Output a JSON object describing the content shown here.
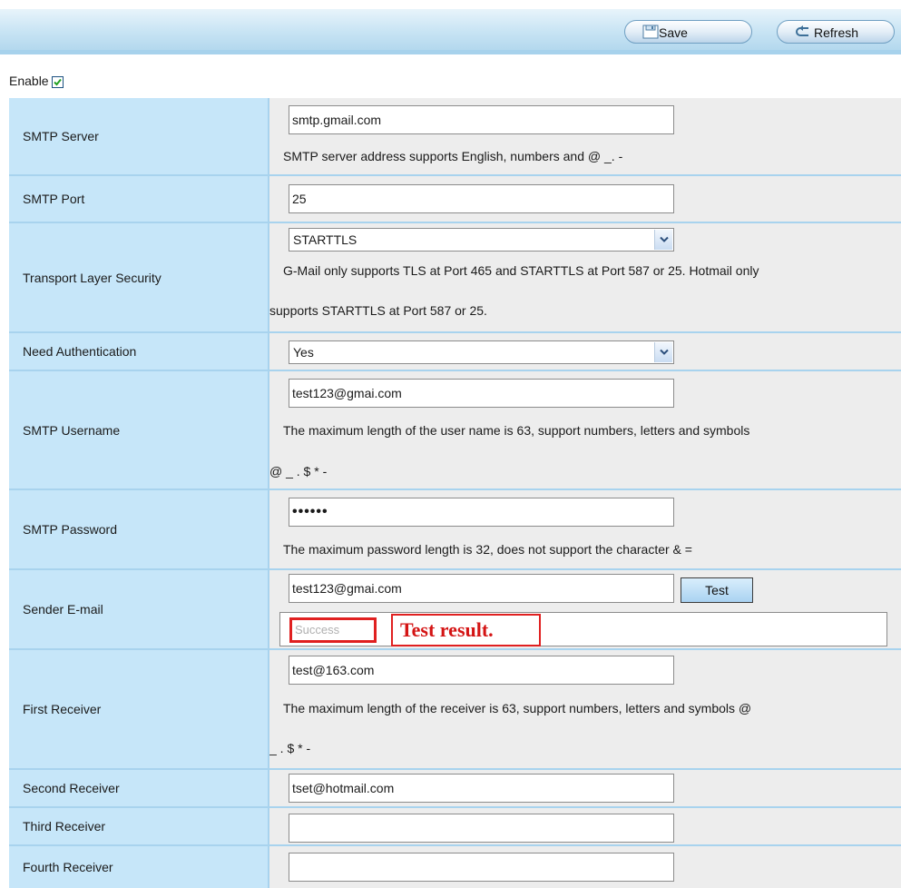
{
  "toolbar": {
    "save_label": "Save",
    "refresh_label": "Refresh"
  },
  "enable": {
    "label": "Enable",
    "checked": true
  },
  "smtp_server": {
    "label": "SMTP Server",
    "value": "smtp.gmail.com",
    "note": "SMTP server address supports English, numbers and @ _. -"
  },
  "smtp_port": {
    "label": "SMTP Port",
    "value": "25"
  },
  "tls": {
    "label": "Transport Layer Security",
    "selected": "STARTTLS",
    "note_line1": "G-Mail only supports TLS at Port 465 and STARTTLS at Port 587 or 25. Hotmail only",
    "note_line2": "supports STARTTLS at Port 587 or 25."
  },
  "need_auth": {
    "label": "Need Authentication",
    "selected": "Yes"
  },
  "smtp_username": {
    "label": "SMTP Username",
    "value": "test123@gmai.com",
    "note_line1": "The maximum length of the user name is 63, support numbers, letters and symbols",
    "note_line2": "@ _ . $ * -"
  },
  "smtp_password": {
    "label": "SMTP Password",
    "value": "••••••",
    "note": "The maximum password length is 32, does not support the character & ="
  },
  "sender_email": {
    "label": "Sender E-mail",
    "value": "test123@gmai.com",
    "test_label": "Test",
    "result_status": "Success",
    "result_annotation": "Test result."
  },
  "first_receiver": {
    "label": "First Receiver",
    "value": "test@163.com",
    "note_line1": "The maximum length of the receiver is 63, support numbers, letters and symbols @",
    "note_line2": "_ . $ * -"
  },
  "second_receiver": {
    "label": "Second Receiver",
    "value": "tset@hotmail.com"
  },
  "third_receiver": {
    "label": "Third Receiver",
    "value": ""
  },
  "fourth_receiver": {
    "label": "Fourth Receiver",
    "value": ""
  },
  "colors": {
    "label_bg": "#c6e6f9",
    "value_bg": "#ededed",
    "grid_line": "#a8d3ee",
    "annotation_red": "#e02020"
  },
  "icons": {
    "save": "floppy-disk-icon",
    "refresh": "refresh-arrow-icon",
    "checkbox": "checkmark-icon",
    "dropdown": "chevron-down-icon"
  }
}
